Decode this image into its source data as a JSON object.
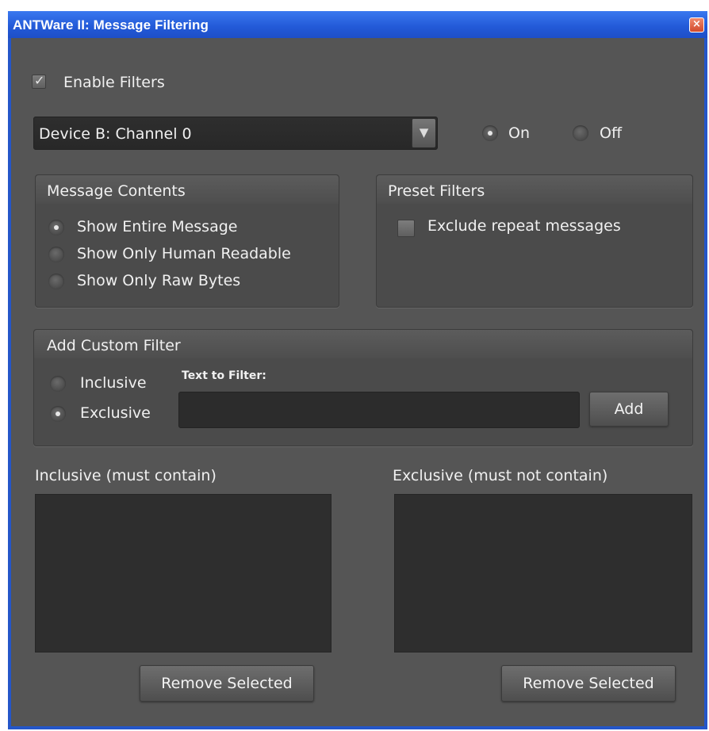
{
  "window": {
    "title": "ANTWare II: Message Filtering",
    "close_glyph": "×"
  },
  "enable_filters": {
    "label": "Enable Filters",
    "checked": true
  },
  "device_select": {
    "value": "Device B: Channel 0"
  },
  "power": {
    "on_label": "On",
    "off_label": "Off",
    "selected": "On"
  },
  "message_contents": {
    "title": "Message Contents",
    "options": [
      "Show Entire Message",
      "Show Only Human Readable",
      "Show Only Raw Bytes"
    ],
    "selected": "Show Entire Message"
  },
  "preset_filters": {
    "title": "Preset Filters",
    "exclude_repeat_label": "Exclude repeat messages",
    "exclude_repeat_checked": false
  },
  "custom_filter": {
    "title": "Add Custom Filter",
    "inclusive_label": "Inclusive",
    "exclusive_label": "Exclusive",
    "selected": "Exclusive",
    "text_label": "Text to Filter:",
    "text_value": "",
    "add_label": "Add"
  },
  "inclusive_list": {
    "title": "Inclusive (must contain)",
    "items": [],
    "remove_label": "Remove Selected"
  },
  "exclusive_list": {
    "title": "Exclusive (must not contain)",
    "items": [],
    "remove_label": "Remove Selected"
  },
  "colors": {
    "titlebar": "#2259d7",
    "background": "#555555",
    "panel": "#4b4b4b",
    "field": "#2c2c2c"
  },
  "icons": {
    "close": "close-icon",
    "dropdown": "chevron-down-icon",
    "check": "checkmark-icon"
  }
}
